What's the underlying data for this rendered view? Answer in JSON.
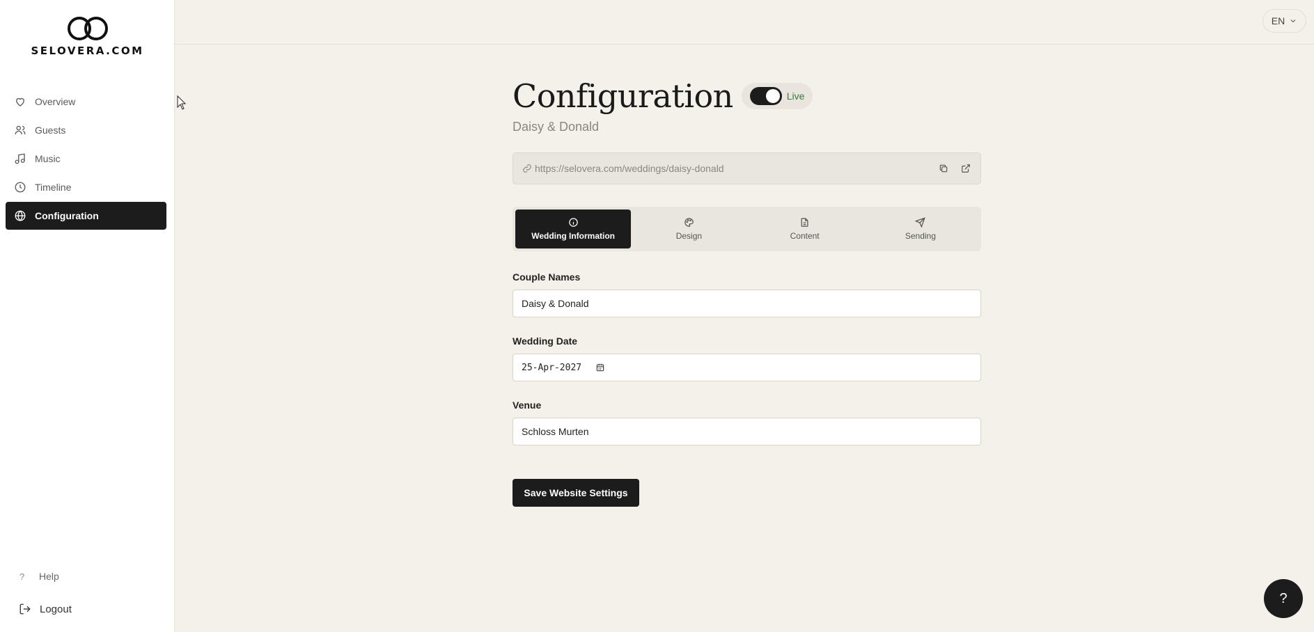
{
  "brand": {
    "logo_text": "SELOVERA.COM"
  },
  "sidebar": {
    "items": [
      {
        "label": "Overview",
        "icon": "heart-icon"
      },
      {
        "label": "Guests",
        "icon": "users-icon"
      },
      {
        "label": "Music",
        "icon": "music-icon"
      },
      {
        "label": "Timeline",
        "icon": "clock-icon"
      },
      {
        "label": "Configuration",
        "icon": "globe-icon",
        "active": true
      }
    ],
    "help_label": "Help",
    "logout_label": "Logout"
  },
  "topbar": {
    "language": "EN"
  },
  "page": {
    "title": "Configuration",
    "status_label": "Live",
    "subtitle": "Daisy & Donald",
    "url": "https://selovera.com/weddings/daisy-donald"
  },
  "tabs": [
    {
      "label": "Wedding Information",
      "icon": "info-icon",
      "active": true
    },
    {
      "label": "Design",
      "icon": "palette-icon"
    },
    {
      "label": "Content",
      "icon": "document-icon"
    },
    {
      "label": "Sending",
      "icon": "send-icon"
    }
  ],
  "form": {
    "couple_names_label": "Couple Names",
    "couple_names_value": "Daisy & Donald",
    "wedding_date_label": "Wedding Date",
    "wedding_date_value": "25-Apr-2027",
    "venue_label": "Venue",
    "venue_value": "Schloss Murten",
    "save_label": "Save Website Settings"
  },
  "fab_label": "?",
  "colors": {
    "accent": "#1c1c1c",
    "background": "#f4f0ea",
    "live": "#2e7d3a"
  }
}
